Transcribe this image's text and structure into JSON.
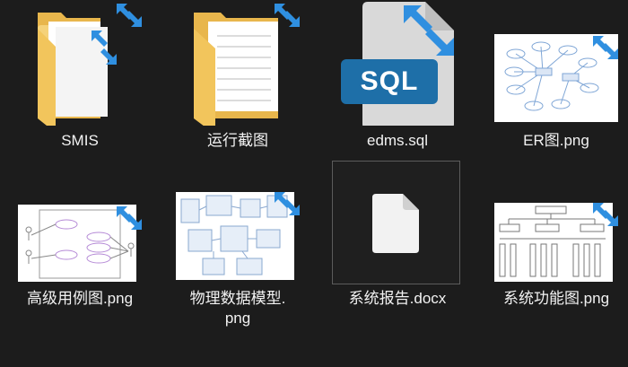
{
  "files": [
    {
      "label": "SMIS",
      "kind": "folder"
    },
    {
      "label": "运行截图",
      "kind": "folder"
    },
    {
      "label": "edms.sql",
      "kind": "sql",
      "icon_text": "SQL"
    },
    {
      "label": "ER图.png",
      "kind": "image"
    },
    {
      "label": "高级用例图.png",
      "kind": "image"
    },
    {
      "label": "物理数据模型.\npng",
      "kind": "image"
    },
    {
      "label": "系统报告.docx",
      "kind": "document"
    },
    {
      "label": "系统功能图.png",
      "kind": "image"
    }
  ],
  "colors": {
    "background": "#1c1c1c",
    "folder": "#f2c55c",
    "sql_badge": "#1e6fa8",
    "sync_arrow": "#2f8fe0"
  },
  "icons": {
    "sync": "sync-arrows-icon",
    "folder": "folder-icon",
    "sql": "sql-file-icon",
    "doc": "blank-document-icon"
  }
}
